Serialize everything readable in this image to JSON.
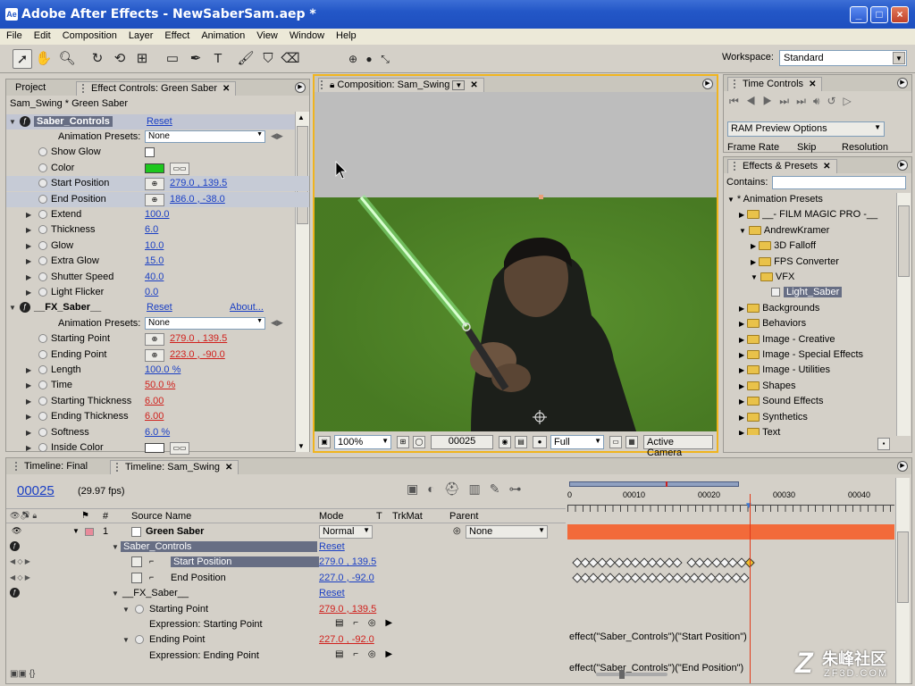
{
  "window": {
    "title": "Adobe After Effects - NewSaberSam.aep *",
    "controls": [
      "_",
      "□",
      "×"
    ]
  },
  "menu": [
    "File",
    "Edit",
    "Composition",
    "Layer",
    "Effect",
    "Animation",
    "View",
    "Window",
    "Help"
  ],
  "workspace": {
    "label": "Workspace:",
    "value": "Standard"
  },
  "effect_controls": {
    "tab_project": "Project",
    "tab_effect": "Effect Controls: Green Saber",
    "breadcrumb": "Sam_Swing * Green Saber",
    "group1": {
      "name": "Saber_Controls",
      "reset": "Reset"
    },
    "rows1": [
      {
        "label": "Animation Presets:",
        "value": "None"
      },
      {
        "label": "Show Glow",
        "value": ""
      },
      {
        "label": "Color",
        "value": ""
      },
      {
        "label": "Start Position",
        "value": "279.0 , 139.5"
      },
      {
        "label": "End Position",
        "value": "186.0 , -38.0"
      },
      {
        "label": "Extend",
        "value": "100.0"
      },
      {
        "label": "Thickness",
        "value": "6.0"
      },
      {
        "label": "Glow",
        "value": "10.0"
      },
      {
        "label": "Extra Glow",
        "value": "15.0"
      },
      {
        "label": "Shutter Speed",
        "value": "40.0"
      },
      {
        "label": "Light Flicker",
        "value": "0.0"
      }
    ],
    "group2": {
      "name": "__FX_Saber__",
      "reset": "Reset",
      "about": "About..."
    },
    "rows2": [
      {
        "label": "Animation Presets:",
        "value": "None"
      },
      {
        "label": "Starting Point",
        "value": "279.0 , 139.5"
      },
      {
        "label": "Ending Point",
        "value": "223.0 , -90.0"
      },
      {
        "label": "Length",
        "value": "100.0 %"
      },
      {
        "label": "Time",
        "value": "50.0 %"
      },
      {
        "label": "Starting Thickness",
        "value": "6.00"
      },
      {
        "label": "Ending Thickness",
        "value": "6.00"
      },
      {
        "label": "Softness",
        "value": "6.0 %"
      },
      {
        "label": "Inside Color",
        "value": ""
      }
    ]
  },
  "composition": {
    "tab": "Composition: Sam_Swing",
    "zoom": "100%",
    "timecode": "00025",
    "resolution": "Full",
    "camera": "Active Camera"
  },
  "time_controls": {
    "tab": "Time Controls",
    "ram_preview": "RAM Preview Options",
    "cols": [
      "Frame Rate",
      "Skip",
      "Resolution"
    ]
  },
  "effects_presets": {
    "tab": "Effects & Presets",
    "contains_label": "Contains:",
    "tree": [
      {
        "label": "* Animation Presets",
        "level": 0,
        "open": true,
        "type": "root"
      },
      {
        "label": "__- FILM MAGIC PRO -__",
        "level": 1,
        "open": false,
        "type": "folder"
      },
      {
        "label": "AndrewKramer",
        "level": 1,
        "open": true,
        "type": "folder"
      },
      {
        "label": "3D Falloff",
        "level": 2,
        "open": false,
        "type": "folder"
      },
      {
        "label": "FPS Converter",
        "level": 2,
        "open": false,
        "type": "folder"
      },
      {
        "label": "VFX",
        "level": 2,
        "open": true,
        "type": "folder"
      },
      {
        "label": "Light_Saber",
        "level": 3,
        "open": false,
        "type": "file"
      },
      {
        "label": "Backgrounds",
        "level": 1,
        "open": false,
        "type": "folder"
      },
      {
        "label": "Behaviors",
        "level": 1,
        "open": false,
        "type": "folder"
      },
      {
        "label": "Image - Creative",
        "level": 1,
        "open": false,
        "type": "folder"
      },
      {
        "label": "Image - Special Effects",
        "level": 1,
        "open": false,
        "type": "folder"
      },
      {
        "label": "Image - Utilities",
        "level": 1,
        "open": false,
        "type": "folder"
      },
      {
        "label": "Shapes",
        "level": 1,
        "open": false,
        "type": "folder"
      },
      {
        "label": "Sound Effects",
        "level": 1,
        "open": false,
        "type": "folder"
      },
      {
        "label": "Synthetics",
        "level": 1,
        "open": false,
        "type": "folder"
      },
      {
        "label": "Text",
        "level": 1,
        "open": false,
        "type": "folder"
      }
    ]
  },
  "timeline": {
    "tab1": "Timeline: Final",
    "tab2": "Timeline: Sam_Swing",
    "timecode": "00025",
    "fps": "(29.97 fps)",
    "headers": {
      "num": "#",
      "source": "Source Name",
      "mode": "Mode",
      "t": "T",
      "trkmat": "TrkMat",
      "parent": "Parent"
    },
    "ruler": [
      "0",
      "00010",
      "00020",
      "00030",
      "00040"
    ],
    "layer": {
      "num": "1",
      "name": "Green Saber",
      "mode": "Normal",
      "parent": "None"
    },
    "props": [
      {
        "label": "Saber_Controls",
        "value": "Reset"
      },
      {
        "label": "Start Position",
        "value": "279.0 , 139.5"
      },
      {
        "label": "End Position",
        "value": "227.0 , -92.0"
      },
      {
        "label": "__FX_Saber__",
        "value": "Reset"
      },
      {
        "label": "Starting Point",
        "value": "279.0 , 139.5"
      },
      {
        "label": "Expression: Starting Point",
        "value": ""
      },
      {
        "label": "Ending Point",
        "value": "227.0 , -92.0"
      },
      {
        "label": "Expression: Ending Point",
        "value": ""
      }
    ],
    "expr1": "effect(\"Saber_Controls\")(\"Start Position\")",
    "expr2": "effect(\"Saber_Controls\")(\"End Position\")"
  },
  "watermark": {
    "text": "朱峰社区",
    "sub": "ZF3D.COM"
  }
}
